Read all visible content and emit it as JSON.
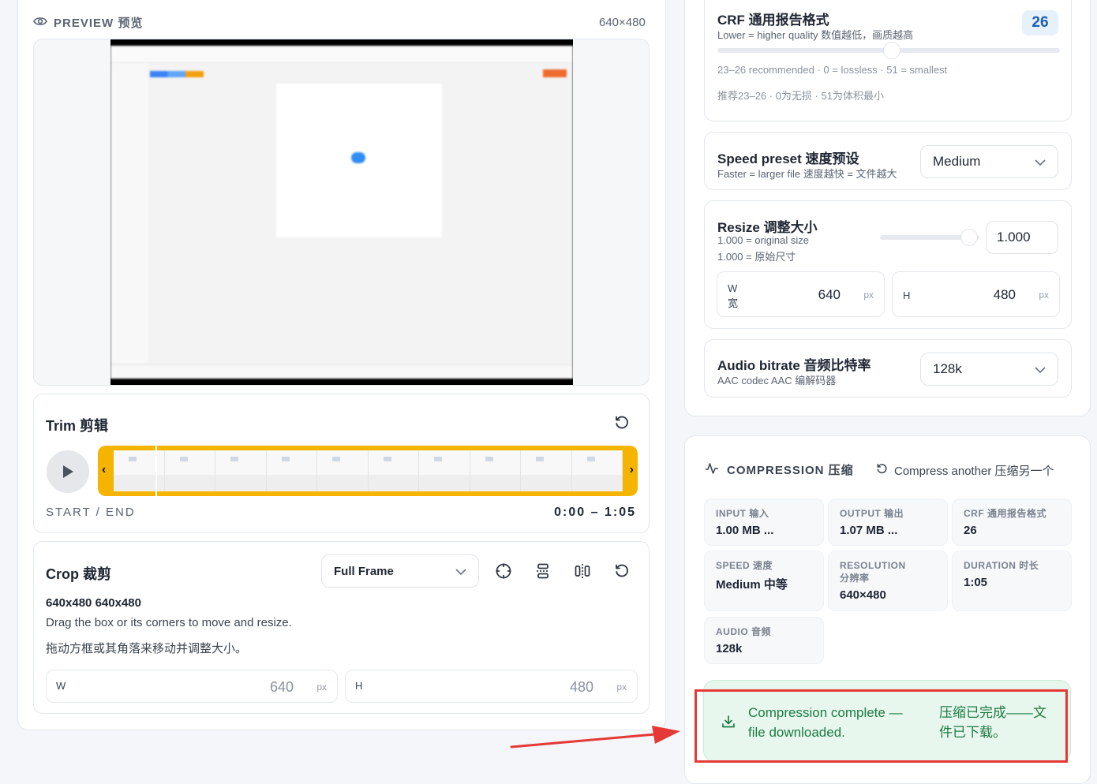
{
  "preview": {
    "label": "PREVIEW 预览",
    "dimensions": "640×480"
  },
  "trim": {
    "title": "Trim 剪辑",
    "start_end_label": "START / END",
    "range": "0:00 – 1:05"
  },
  "crop": {
    "title": "Crop 裁剪",
    "mode": "Full Frame",
    "dims": "640x480 640x480",
    "hint_en": "Drag the box or its corners to move and resize.",
    "hint_zh": "拖动方框或其角落来移动并调整大小。",
    "w_label": "W",
    "w_value": "640",
    "h_label": "H",
    "h_value": "480",
    "unit": "px"
  },
  "crf": {
    "title": "CRF 通用报告格式",
    "subtitle": "Lower = higher quality 数值越低，画质越高",
    "value": "26",
    "slider_fraction": 0.51,
    "hint_en": "23–26 recommended · 0 = lossless · 51 = smallest",
    "hint_zh": "推荐23–26 · 0为无损 · 51为体积最小"
  },
  "speed": {
    "title": "Speed preset 速度预设",
    "subtitle": "Faster = larger file 速度越快 = 文件越大",
    "value": "Medium"
  },
  "resize": {
    "title": "Resize 调整大小",
    "sub_en": "1.000 = original size",
    "sub_zh": "1.000 = 原始尺寸",
    "value": "1.000",
    "slider_fraction": 0.9,
    "w_label": "W",
    "w_label_zh": "宽",
    "w_value": "640",
    "h_label": "H",
    "h_value": "480",
    "unit": "px"
  },
  "audio": {
    "title": "Audio bitrate 音频比特率",
    "subtitle": "AAC codec AAC 编解码器",
    "value": "128k"
  },
  "compression": {
    "title": "COMPRESSION 压缩",
    "again": "Compress another  压缩另一个",
    "stats": [
      {
        "key": "INPUT 输入",
        "value": "1.00 MB ..."
      },
      {
        "key": "OUTPUT 输出",
        "value": "1.07 MB ..."
      },
      {
        "key": "CRF 通用报告格式",
        "value": "26"
      },
      {
        "key": "SPEED 速度",
        "value": "Medium 中等"
      },
      {
        "key": "RESOLUTION 分辨率",
        "value": "640×480"
      },
      {
        "key": "DURATION 时长",
        "value": "1:05"
      },
      {
        "key": "AUDIO 音频",
        "value": "128k"
      }
    ],
    "done_en_1": "Compression complete —",
    "done_en_2": "file downloaded.",
    "done_zh_1": "压缩已完成——文",
    "done_zh_2": "件已下载。"
  },
  "colors": {
    "accent_yellow": "#f5b400",
    "success_green": "#1c7a43",
    "highlight_red": "#e53935"
  }
}
